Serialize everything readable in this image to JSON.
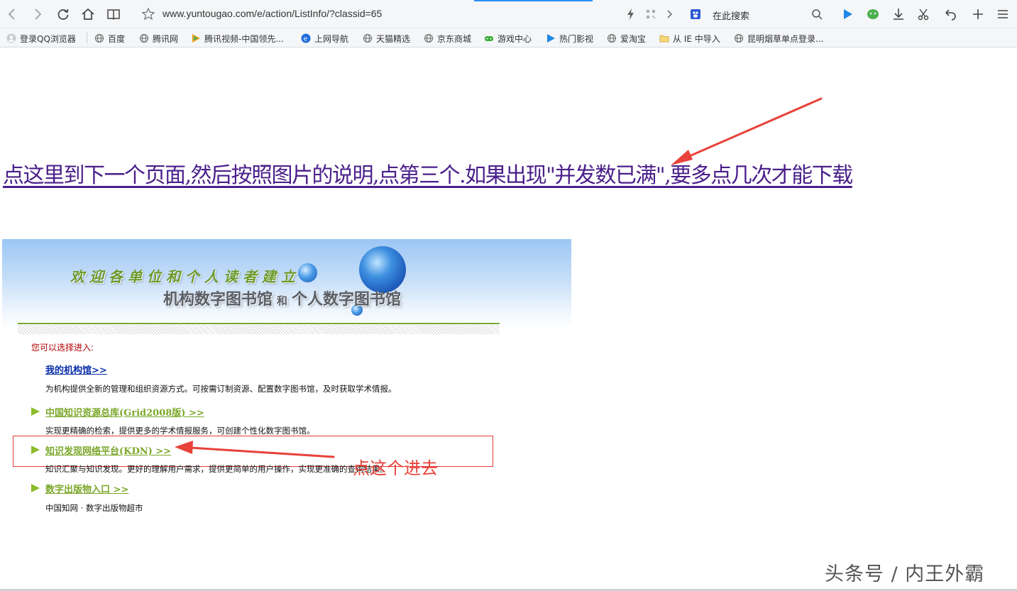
{
  "browser": {
    "url": "www.yuntougao.com/e/action/ListInfo/?classid=65",
    "search_placeholder": "在此搜索",
    "nav_icons": [
      "back-icon",
      "forward-icon",
      "refresh-icon",
      "home-icon",
      "reader-icon",
      "star-icon"
    ],
    "right_icons": [
      "lightning-icon",
      "qr-icon",
      "chevron-right-icon",
      "paw-icon",
      "magnifier-icon",
      "play-icon",
      "wechat-icon",
      "download-icon",
      "scissors-icon",
      "undo-icon",
      "plus-icon",
      "menu-icon"
    ]
  },
  "bookmarks": [
    {
      "label": "登录QQ浏览器",
      "icon": "user-icon"
    },
    {
      "label": "百度",
      "icon": "globe-icon"
    },
    {
      "label": "腾讯网",
      "icon": "globe-icon"
    },
    {
      "label": "腾讯视频-中国领先...",
      "icon": "video-play-icon"
    },
    {
      "label": "上网导航",
      "icon": "ie-icon"
    },
    {
      "label": "天猫精选",
      "icon": "globe-icon"
    },
    {
      "label": "京东商城",
      "icon": "globe-icon"
    },
    {
      "label": "游戏中心",
      "icon": "gamepad-icon"
    },
    {
      "label": "热门影视",
      "icon": "play-icon"
    },
    {
      "label": "爱淘宝",
      "icon": "globe-icon"
    },
    {
      "label": "从 IE 中导入",
      "icon": "folder-icon"
    },
    {
      "label": "昆明烟草单点登录...",
      "icon": "globe-icon"
    }
  ],
  "page": {
    "main_link": "点这里到下一个页面,然后按照图片的说明,点第三个.如果出现\"并发数已满\",要多点几次才能下载",
    "banner": {
      "line1": "欢迎各单位和个人读者建立",
      "line2_left": "机构数字图书馆",
      "line2_mid": "和",
      "line2_right": "个人数字图书馆"
    },
    "choose_label": "您可以选择进入:",
    "entries": [
      {
        "title": "我的机构馆>>",
        "desc": "为机构提供全新的管理和组织资源方式。可按需订制资源、配置数字图书馆，及时获取学术情报。"
      },
      {
        "title": "中国知识资源总库(Grid2008版) >>",
        "desc": "实现更精确的检索，提供更多的学术情报服务，可创建个性化数字图书馆。"
      },
      {
        "title": "知识发现网络平台(KDN) >>",
        "desc": "知识汇聚与知识发现。更好的理解用户需求，提供更简单的用户操作，实现更准确的查询结果。"
      },
      {
        "title": "数字出版物入口 >>",
        "desc": "中国知网 · 数字出版物超市"
      }
    ],
    "annotation": "点这个进去",
    "watermark": "头条号 / 内王外霸"
  },
  "colors": {
    "link_purple": "#4a1f8a",
    "annotation_red": "#e8423a",
    "entry_green": "#7aa728",
    "entry_blue": "#0b2fa8"
  }
}
